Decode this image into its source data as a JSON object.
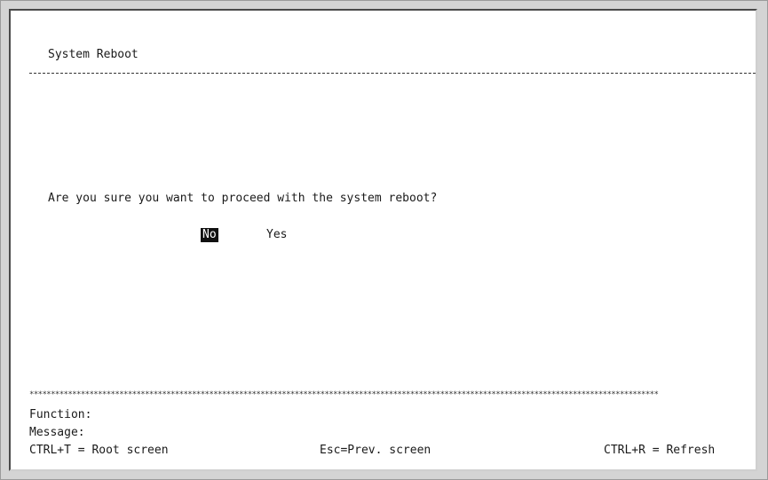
{
  "screen": {
    "title": "System Reboot",
    "prompt": "Are you sure you want to proceed with the system reboot?",
    "options": {
      "no_label": "No",
      "yes_label": "Yes",
      "selected": "No"
    },
    "separator": "***************************************************************************************************************************************************"
  },
  "footer": {
    "function_label": "Function:",
    "message_label": "Message:",
    "hint_root": "CTRL+T = Root screen",
    "hint_prev": "Esc=Prev. screen",
    "hint_refresh": "CTRL+R = Refresh"
  }
}
